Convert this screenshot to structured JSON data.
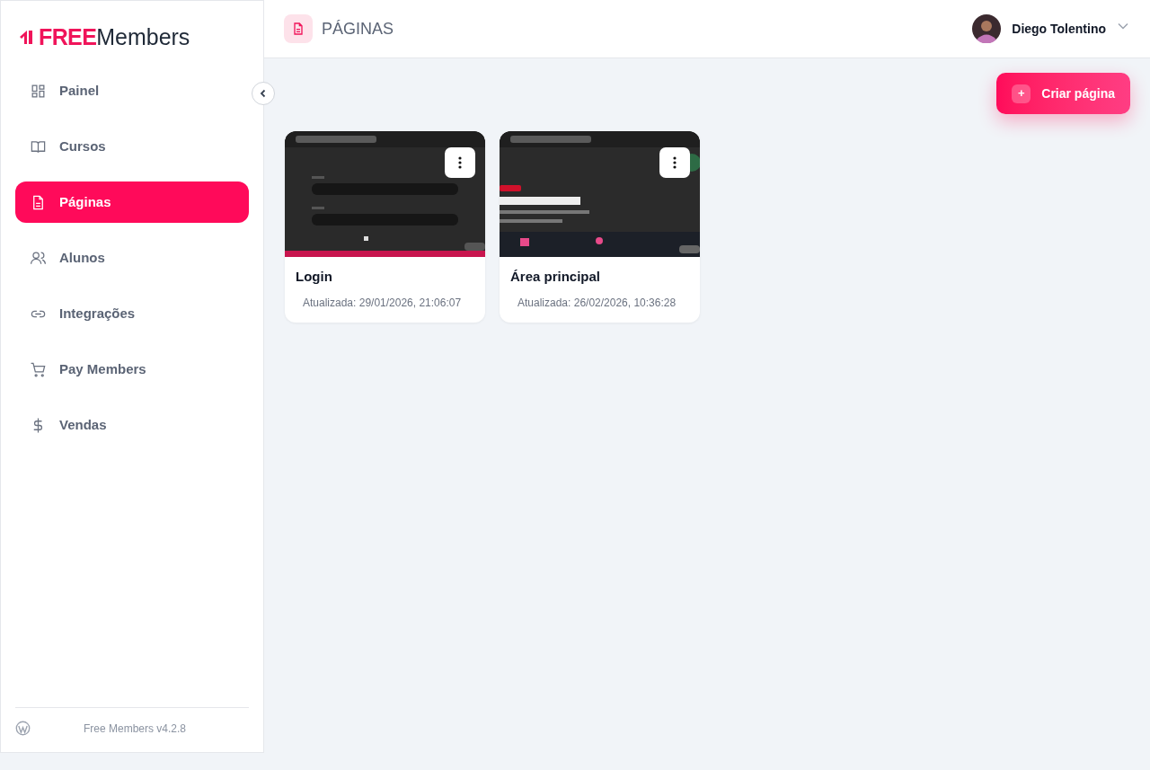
{
  "sidebar": {
    "logo": {
      "brand": "FREE",
      "name": "Members"
    },
    "items": [
      {
        "label": "Painel",
        "kind": "grid",
        "selected": false
      },
      {
        "label": "Cursos",
        "kind": "book",
        "selected": false
      },
      {
        "label": "Páginas",
        "kind": "file",
        "selected": true
      },
      {
        "label": "Alunos",
        "kind": "users",
        "selected": false
      },
      {
        "label": "Integrações",
        "kind": "link",
        "selected": false
      },
      {
        "label": "Pay Members",
        "kind": "cart",
        "selected": false
      },
      {
        "label": "Vendas",
        "kind": "dollar",
        "selected": false
      }
    ],
    "footer": {
      "version": "Free Members v4.2.8"
    }
  },
  "header": {
    "title": "PÁGINAS",
    "user": {
      "name": "Diego Tolentino"
    }
  },
  "create_button": {
    "label": "Criar página",
    "icon": "+"
  },
  "pages": [
    {
      "title": "Login",
      "updated": "Atualizada: 29/01/2026, 21:06:07"
    },
    {
      "title": "Área principal",
      "updated": "Atualizada: 26/02/2026, 10:36:28"
    }
  ]
}
